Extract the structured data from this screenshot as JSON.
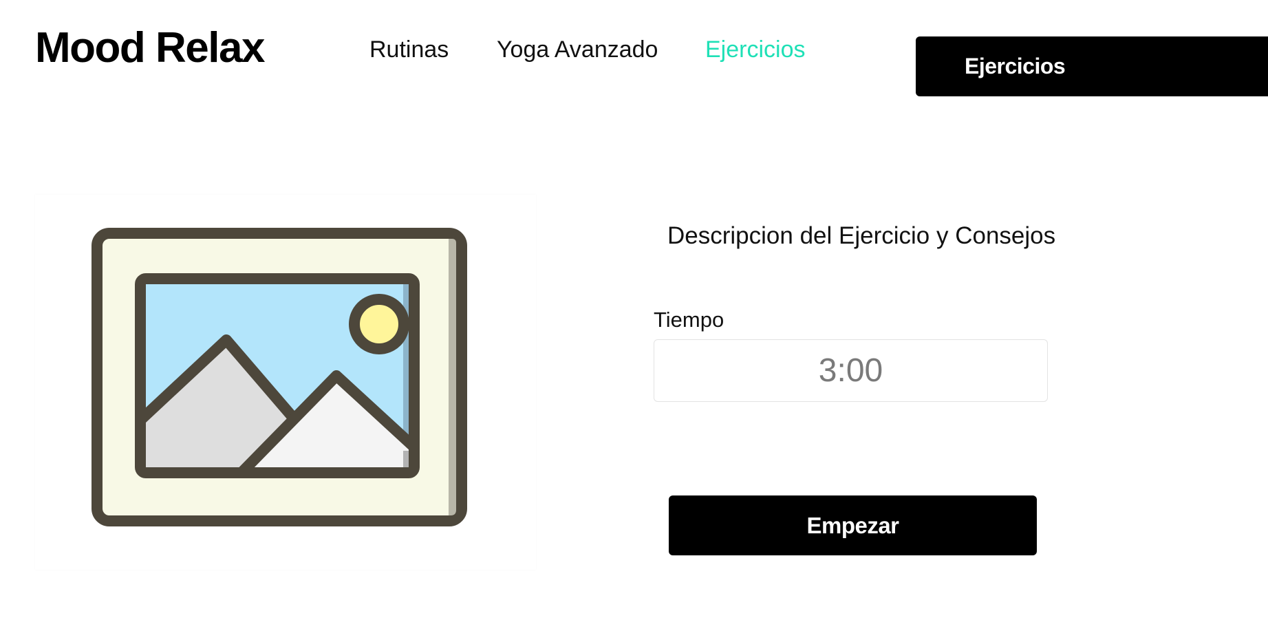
{
  "header": {
    "logo_text": "Mood Relax",
    "nav": [
      {
        "label": "Rutinas",
        "active": false
      },
      {
        "label": "Yoga Avanzado",
        "active": false
      },
      {
        "label": "Ejercicios",
        "active": true
      }
    ],
    "action_button_label": "Ejercicios"
  },
  "main": {
    "image": {
      "icon": "image-placeholder-icon"
    },
    "description_title": "Descripcion del Ejercicio y Consejos",
    "time": {
      "label": "Tiempo",
      "placeholder": "3:00"
    },
    "start_button_label": "Empezar"
  },
  "colors": {
    "accent": "#1ee0b6",
    "button_bg": "#000000",
    "button_text": "#ffffff"
  }
}
